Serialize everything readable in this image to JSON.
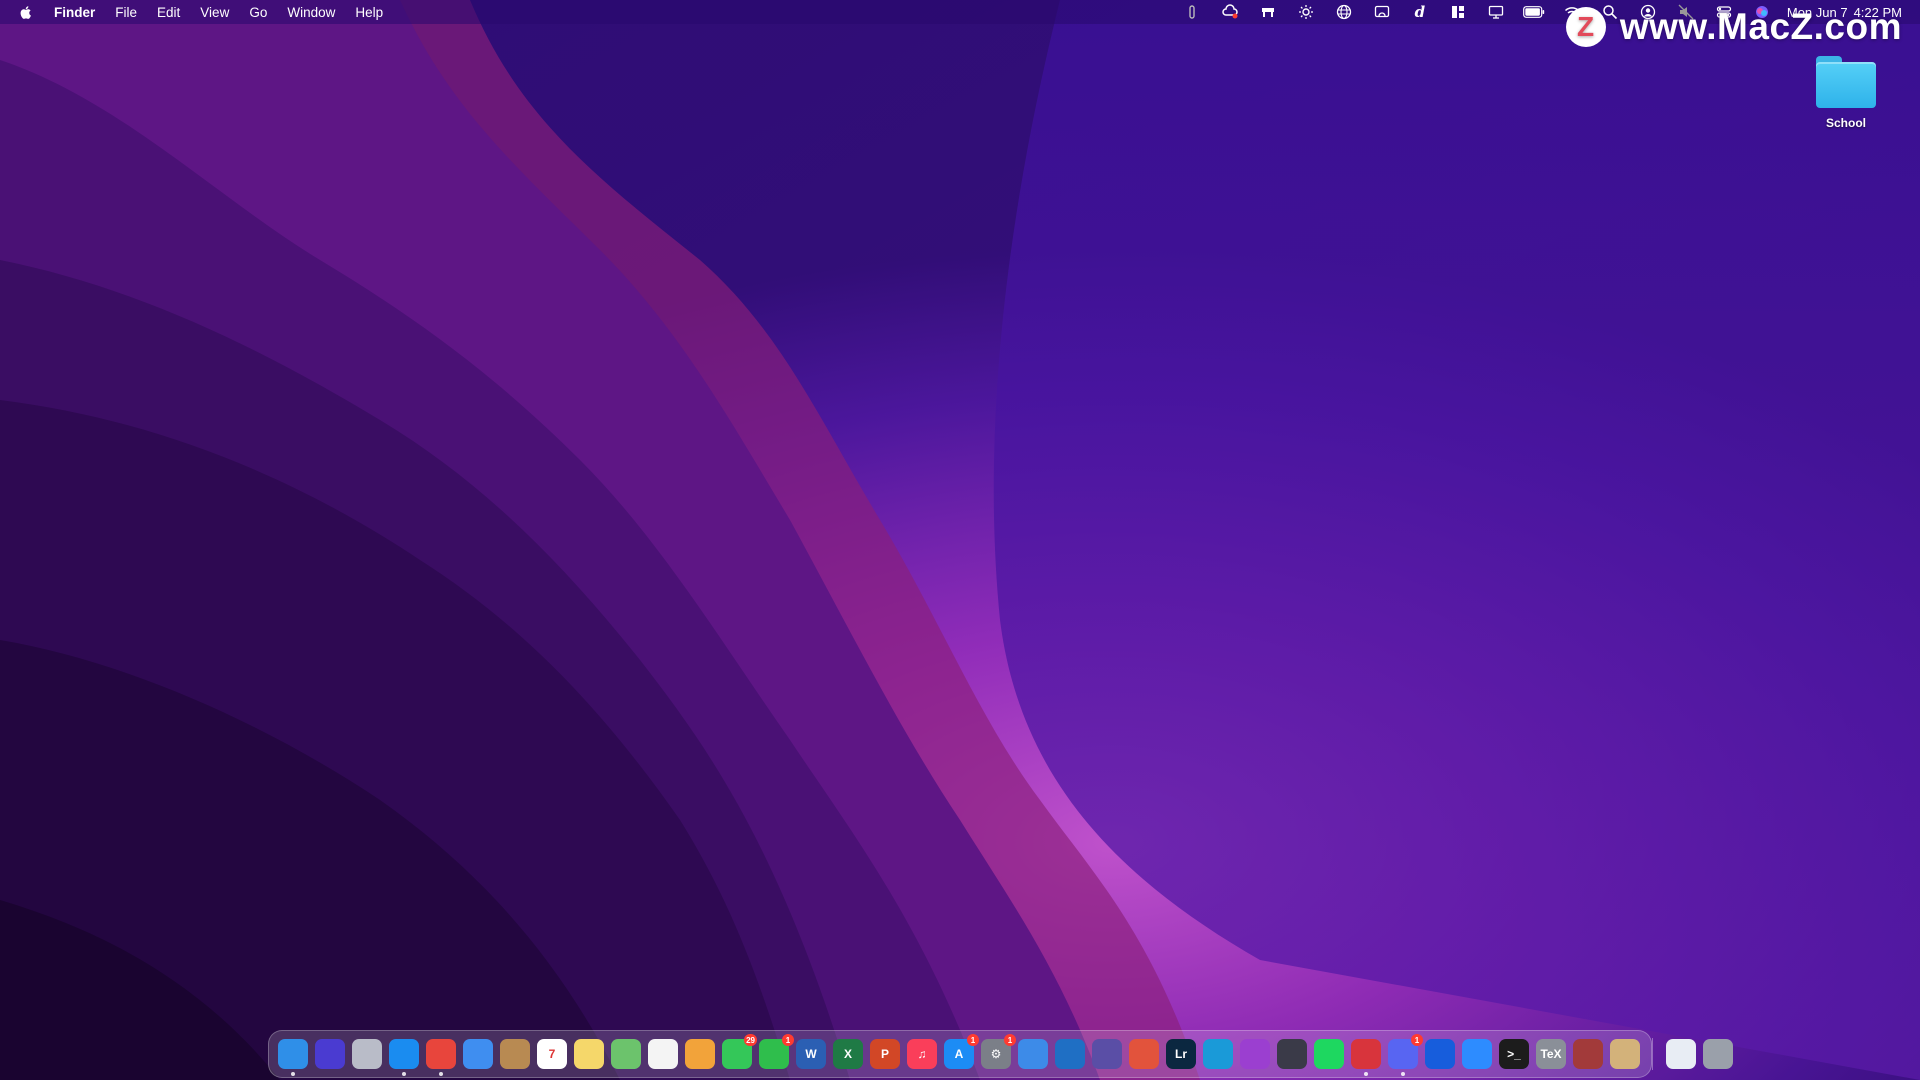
{
  "menubar": {
    "app_name": "Finder",
    "menus": [
      "File",
      "Edit",
      "View",
      "Go",
      "Window",
      "Help"
    ],
    "status_icons": [
      "bartender-icon",
      "creative-cloud-icon",
      "desk-icon",
      "brightness-icon",
      "globe-icon",
      "screen-mirror-icon",
      "dictionary-icon",
      "grid-icon",
      "display-icon",
      "battery-icon",
      "wifi-icon",
      "spotlight-icon",
      "user-icon",
      "mute-icon",
      "control-center-icon",
      "siri-icon"
    ],
    "date": "Mon Jun 7",
    "time": "4:22 PM"
  },
  "watermark": {
    "logo_letter": "Z",
    "text": "www.MacZ.com"
  },
  "desktop": {
    "folder": {
      "label": "School",
      "icon": "folder-icon"
    }
  },
  "dock": {
    "apps": [
      {
        "name": "finder",
        "glyph": "",
        "color": "#2f8fe8",
        "running": true
      },
      {
        "name": "siri",
        "glyph": "",
        "color": "#4a3bd1",
        "running": false
      },
      {
        "name": "launchpad",
        "glyph": "",
        "color": "#b9bcc8",
        "running": false
      },
      {
        "name": "safari",
        "glyph": "",
        "color": "#1a8cf0",
        "running": true
      },
      {
        "name": "chrome",
        "glyph": "",
        "color": "#e8453c",
        "running": true
      },
      {
        "name": "mail",
        "glyph": "",
        "color": "#3f8ef0",
        "running": false
      },
      {
        "name": "contacts",
        "glyph": "",
        "color": "#b88a52",
        "running": false
      },
      {
        "name": "calendar",
        "glyph": "7",
        "color": "#ffffff",
        "running": false
      },
      {
        "name": "notes",
        "glyph": "",
        "color": "#f5d76a",
        "running": false
      },
      {
        "name": "maps",
        "glyph": "",
        "color": "#6cc36c",
        "running": false
      },
      {
        "name": "reminders",
        "glyph": "",
        "color": "#f4f4f4",
        "running": false
      },
      {
        "name": "photos",
        "glyph": "",
        "color": "#f2a33a",
        "running": false
      },
      {
        "name": "messages",
        "glyph": "",
        "color": "#34c759",
        "running": false,
        "badge": "29"
      },
      {
        "name": "facetime",
        "glyph": "",
        "color": "#2fbe4c",
        "running": false,
        "badge": "1"
      },
      {
        "name": "word",
        "glyph": "W",
        "color": "#2b5fb3",
        "running": false
      },
      {
        "name": "excel",
        "glyph": "X",
        "color": "#1f7a45",
        "running": false
      },
      {
        "name": "powerpoint",
        "glyph": "P",
        "color": "#d24726",
        "running": false
      },
      {
        "name": "music",
        "glyph": "♫",
        "color": "#fa3e5a",
        "running": false
      },
      {
        "name": "app-store",
        "glyph": "A",
        "color": "#1c8cf5",
        "running": false,
        "badge": "1"
      },
      {
        "name": "system-preferences",
        "glyph": "⚙",
        "color": "#7b7f88",
        "running": false,
        "badge": "1"
      },
      {
        "name": "xcode",
        "glyph": "",
        "color": "#3d8be8",
        "running": false
      },
      {
        "name": "vscode",
        "glyph": "",
        "color": "#1f6fc4",
        "running": false
      },
      {
        "name": "github-desktop",
        "glyph": "",
        "color": "#5a4ea6",
        "running": false
      },
      {
        "name": "git-client",
        "glyph": "",
        "color": "#e2533c",
        "running": false
      },
      {
        "name": "lightroom",
        "glyph": "Lr",
        "color": "#0b2740",
        "running": false
      },
      {
        "name": "affinity-designer",
        "glyph": "",
        "color": "#1a9ad8",
        "running": false
      },
      {
        "name": "affinity-photo",
        "glyph": "",
        "color": "#9b3fd0",
        "running": false
      },
      {
        "name": "davinci-resolve",
        "glyph": "",
        "color": "#3a3a48",
        "running": false
      },
      {
        "name": "spotify",
        "glyph": "",
        "color": "#1ed760",
        "running": false
      },
      {
        "name": "parallels",
        "glyph": "",
        "color": "#d8343c",
        "running": true
      },
      {
        "name": "discord",
        "glyph": "",
        "color": "#5865f2",
        "running": true,
        "badge": "1"
      },
      {
        "name": "bitwarden",
        "glyph": "",
        "color": "#175ddc",
        "running": false
      },
      {
        "name": "zoom",
        "glyph": "",
        "color": "#2d8cff",
        "running": false
      },
      {
        "name": "terminal",
        "glyph": ">_",
        "color": "#1c1c1c",
        "running": false
      },
      {
        "name": "tex",
        "glyph": "TeX",
        "color": "#8a8f98",
        "running": false
      },
      {
        "name": "nutcracker-app",
        "glyph": "",
        "color": "#a23a3a",
        "running": false
      },
      {
        "name": "archive-utility",
        "glyph": "",
        "color": "#d3b27a",
        "running": false
      }
    ],
    "utilities": [
      {
        "name": "downloads-stack",
        "glyph": "",
        "color": "#e8edf4"
      },
      {
        "name": "trash",
        "glyph": "",
        "color": "#9aa0aa"
      }
    ]
  }
}
